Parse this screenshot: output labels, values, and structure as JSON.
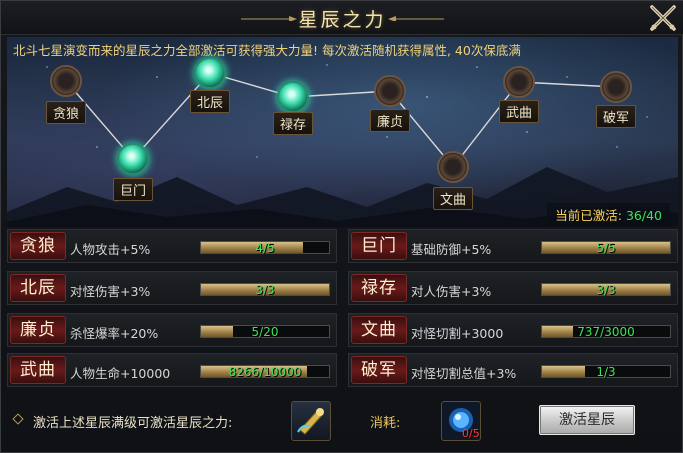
{
  "window": {
    "title": "星辰之力",
    "close_icon": "close-crossed-swords-icon"
  },
  "intro": "北斗七星演变而来的星辰之力全部激活可获得强大力量! 每次激活随机获得属性, 40次保底满",
  "constellation": {
    "nodes": [
      {
        "name": "贪狼",
        "active": false
      },
      {
        "name": "巨门",
        "active": true
      },
      {
        "name": "北辰",
        "active": true
      },
      {
        "name": "禄存",
        "active": true
      },
      {
        "name": "廉贞",
        "active": false
      },
      {
        "name": "文曲",
        "active": false
      },
      {
        "name": "武曲",
        "active": false
      },
      {
        "name": "破军",
        "active": false
      }
    ],
    "active_label": "当前已激活:",
    "active_value": "36/40"
  },
  "stars": [
    {
      "name": "贪狼",
      "attr": "人物攻击+5%",
      "progress_text": "4/5",
      "progress": 0.8
    },
    {
      "name": "巨门",
      "attr": "基础防御+5%",
      "progress_text": "5/5",
      "progress": 1.0
    },
    {
      "name": "北辰",
      "attr": "对怪伤害+3%",
      "progress_text": "3/3",
      "progress": 1.0
    },
    {
      "name": "禄存",
      "attr": "对人伤害+3%",
      "progress_text": "3/3",
      "progress": 1.0
    },
    {
      "name": "廉贞",
      "attr": "杀怪爆率+20%",
      "progress_text": "5/20",
      "progress": 0.25
    },
    {
      "name": "文曲",
      "attr": "对怪切割+3000",
      "progress_text": "737/3000",
      "progress": 0.2457
    },
    {
      "name": "武曲",
      "attr": "人物生命+10000",
      "progress_text": "8266/10000",
      "progress": 0.8266
    },
    {
      "name": "破军",
      "attr": "对怪切割总值+3%",
      "progress_text": "1/3",
      "progress": 0.3333
    }
  ],
  "footer": {
    "hint": "激活上述星辰满级可激活星辰之力:",
    "reward_icon": "golden-scroll-item-icon",
    "cost_label": "消耗:",
    "cost_icon": "blue-star-orb-item-icon",
    "cost_count": "0/5",
    "activate_button": "激活星辰"
  },
  "colors": {
    "title": "#f2e3b2",
    "intro_text": "#f1d27a",
    "active_green": "#3fe35a",
    "badge_red": "#6a1a1a",
    "bar_gold": "#c8ad72",
    "cost_red": "#ff3b3b"
  }
}
